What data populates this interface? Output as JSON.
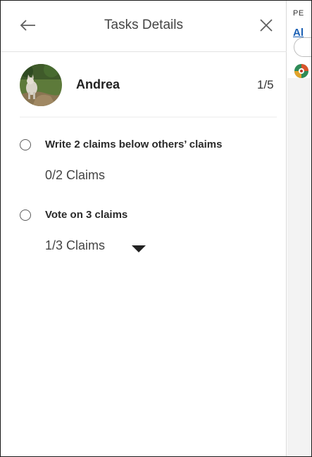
{
  "drawer": {
    "title": "Tasks Details",
    "back_icon": "arrow-left-icon",
    "close_icon": "close-icon"
  },
  "user": {
    "name": "Andrea",
    "counter": "1/5"
  },
  "tasks": [
    {
      "label": "Write 2 claims below others’ claims",
      "progress": "0/2 Claims"
    },
    {
      "label": "Vote on 3 claims",
      "progress": "1/3 Claims"
    }
  ],
  "background": {
    "header_text": "PE",
    "link_text": "Al"
  }
}
